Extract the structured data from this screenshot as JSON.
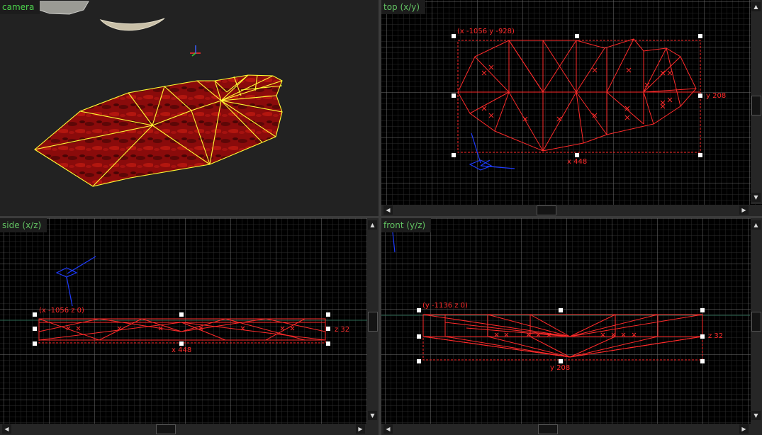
{
  "viewports": {
    "camera": {
      "label": "camera"
    },
    "top": {
      "label": "top (x/y)",
      "origin_label": "(x -1056 y -928)",
      "width_label": "x 448",
      "height_label": "y 208"
    },
    "side": {
      "label": "side (x/z)",
      "origin_label": "(x -1056 z 0)",
      "width_label": "x 448",
      "height_label": "z 32"
    },
    "front": {
      "label": "front (y/z)",
      "origin_label": "(y -1136 z 0)",
      "width_label": "y 208",
      "height_label": "z 32"
    }
  },
  "icons": {
    "scroll_left": "◀",
    "scroll_right": "▶",
    "scroll_up": "▲",
    "scroll_down": "▼"
  },
  "colors": {
    "grid_minor": "#2a2a2a",
    "grid_major": "#6e6e6e",
    "brush": "#ff2a2a",
    "wireframe_camera": "#ffff33",
    "surface": "#8a0b0b",
    "handle": "#ffffff",
    "gizmo": "#1f3cff"
  }
}
